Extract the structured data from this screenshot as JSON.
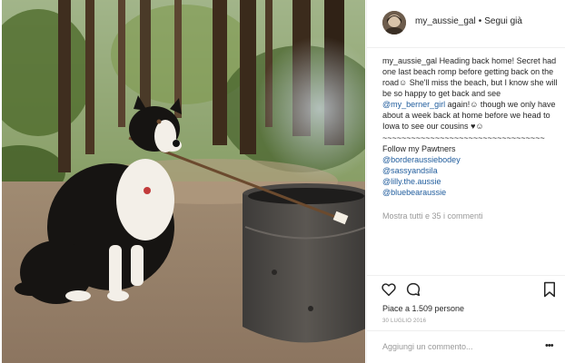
{
  "header": {
    "username": "my_aussie_gal",
    "separator": "•",
    "follow_label": "Segui già"
  },
  "caption": {
    "username": "my_aussie_gal",
    "text_1": "Heading back home! Secret had one last beach romp before getting back on the road",
    "emoji_1": "☺",
    "text_2": " She'll miss the beach, but I know she will be so happy to get back and see ",
    "mention_1": "@my_berner_girl",
    "text_3": " again!",
    "emoji_2": "☺",
    "text_4": " though we only have about a week back at home before we head to Iowa to see our cousins ",
    "emoji_3": "♥☺",
    "divider_line": "~~~~~~~~~~~~~~~~~~~~~~~~~~~~~~~~~~",
    "follow_label": "Follow my Pawtners",
    "mentions": [
      "@borderaussiebodey",
      "@sassyandsila",
      "@lilly.the.aussie",
      "@bluebearaussie"
    ],
    "more_comments": "Mostra tutti e 35 i commenti"
  },
  "actions": {
    "like_icon": "heart-icon",
    "comment_icon": "comment-icon",
    "save_icon": "bookmark-icon"
  },
  "likes": "Piace a 1.509 persone",
  "date": "30 LUGLIO 2016",
  "comment_input": {
    "placeholder": "Aggiungi un commento...",
    "more_icon": "more-icon",
    "more_glyph": "•••"
  },
  "colors": {
    "mention": "#1e5b9c",
    "muted": "#999999",
    "text": "#262626",
    "border": "#efefef"
  }
}
